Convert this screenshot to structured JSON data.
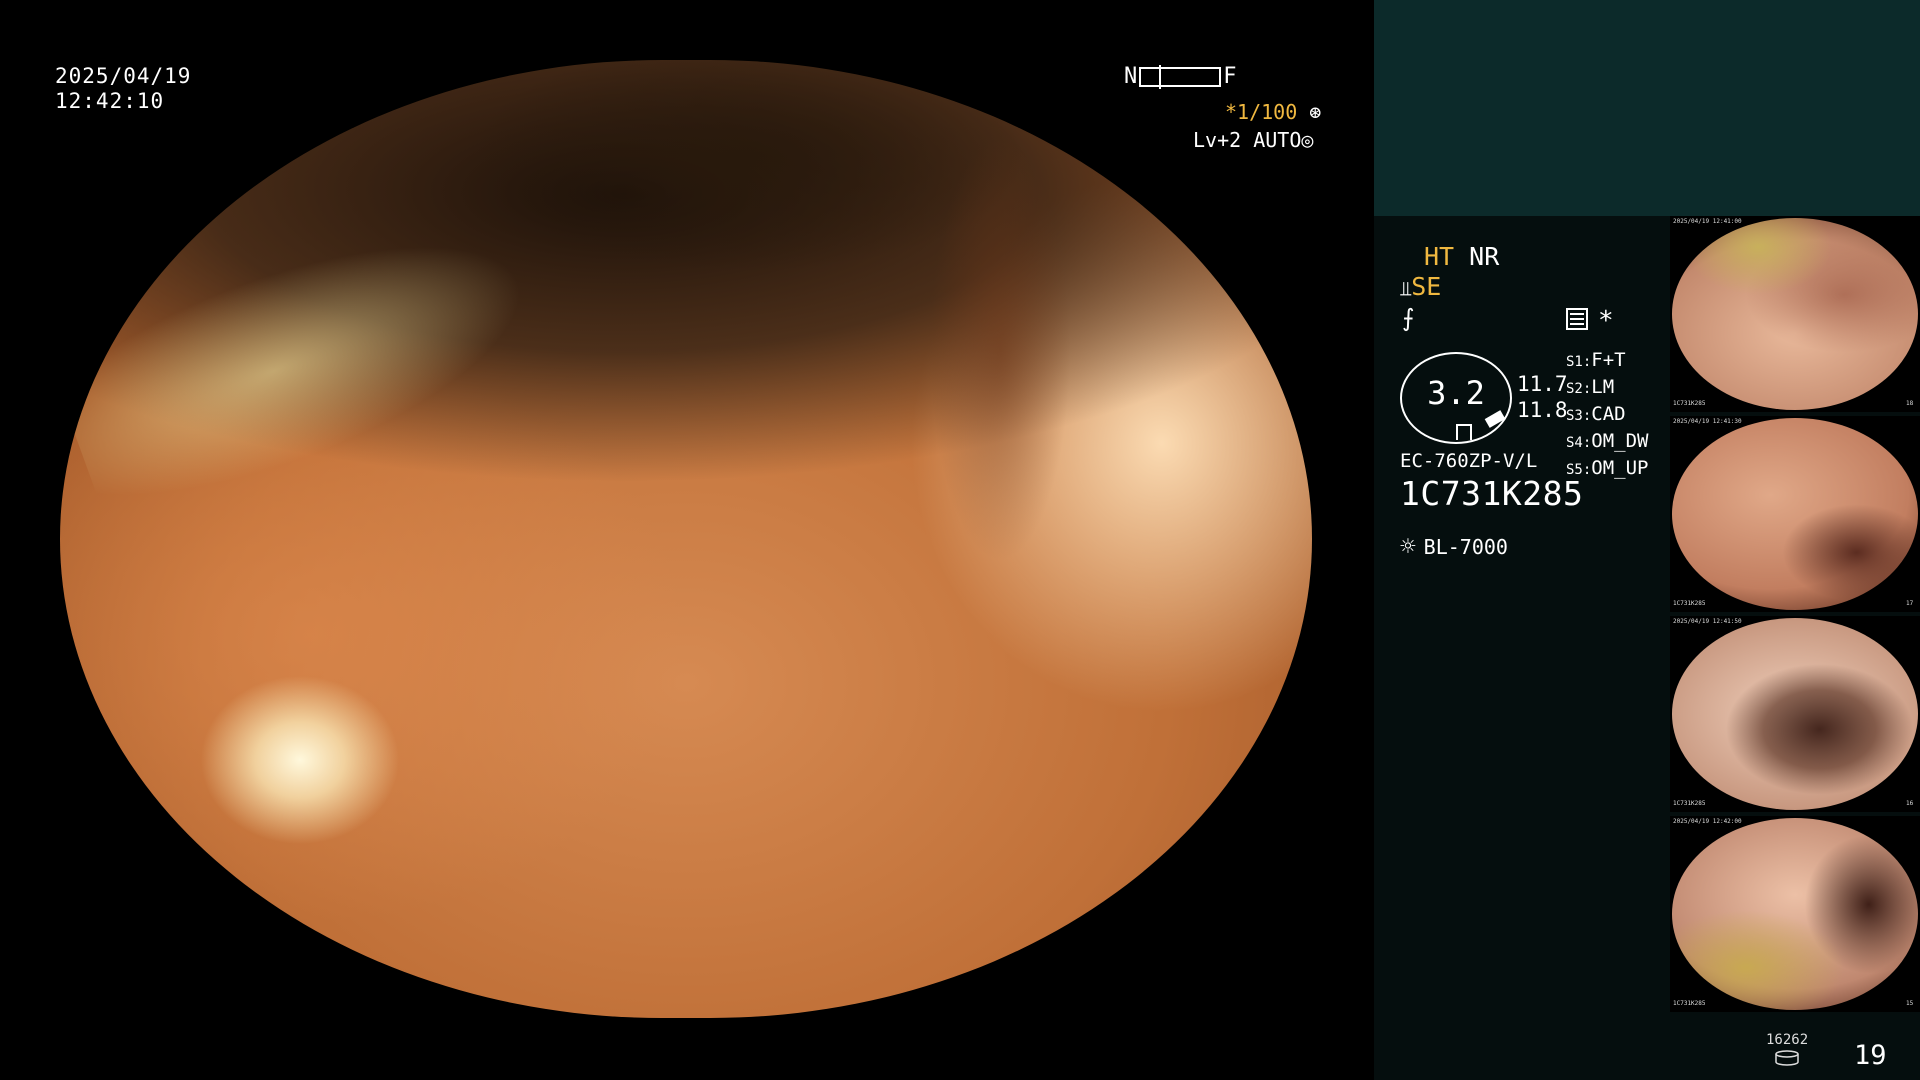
{
  "overlay": {
    "date": "2025/04/19",
    "time": "12:42:10",
    "near_far_left": "N",
    "near_far_right": "F",
    "shutter": "*1/100",
    "shutter_icon": "aperture-icon",
    "level": "Lv+2",
    "exposure_mode": "AUTO",
    "exposure_icon": "aperture-icon"
  },
  "status": {
    "ht": "HT",
    "nr": "NR",
    "se": "SE",
    "se_icon": "scope-tip-icon",
    "freeze_icon": "lightning-icon",
    "menu_icon": "settings-panel-icon",
    "star": "*"
  },
  "scope": {
    "value": "3.2",
    "left_value": "11.7",
    "right_value": "11.8",
    "model": "EC-760ZP-V/L",
    "serial": "1C731K285",
    "light_source": "BL-7000",
    "light_icon": "lamp-icon"
  },
  "switches": [
    {
      "tag": "S1:",
      "label": "F+T"
    },
    {
      "tag": "S2:",
      "label": "LM"
    },
    {
      "tag": "S3:",
      "label": "CAD"
    },
    {
      "tag": "S4:",
      "label": "OM_DW"
    },
    {
      "tag": "S5:",
      "label": "OM_UP"
    }
  ],
  "thumbnails": [
    {
      "caption_top": "2025/04/19 12:41:00",
      "caption_bottom": "1C731K285",
      "index": "18"
    },
    {
      "caption_top": "2025/04/19 12:41:30",
      "caption_bottom": "1C731K285",
      "index": "17"
    },
    {
      "caption_top": "2025/04/19 12:41:50",
      "caption_bottom": "1C731K285",
      "index": "16"
    },
    {
      "caption_top": "2025/04/19 12:42:00",
      "caption_bottom": "1C731K285",
      "index": "15"
    }
  ],
  "counter": {
    "count": "16262",
    "count_icon": "database-icon",
    "number": "19"
  },
  "colors": {
    "accent": "#f0b840",
    "panel_top": "#0c2a2a",
    "panel_bg": "#050e0e"
  }
}
